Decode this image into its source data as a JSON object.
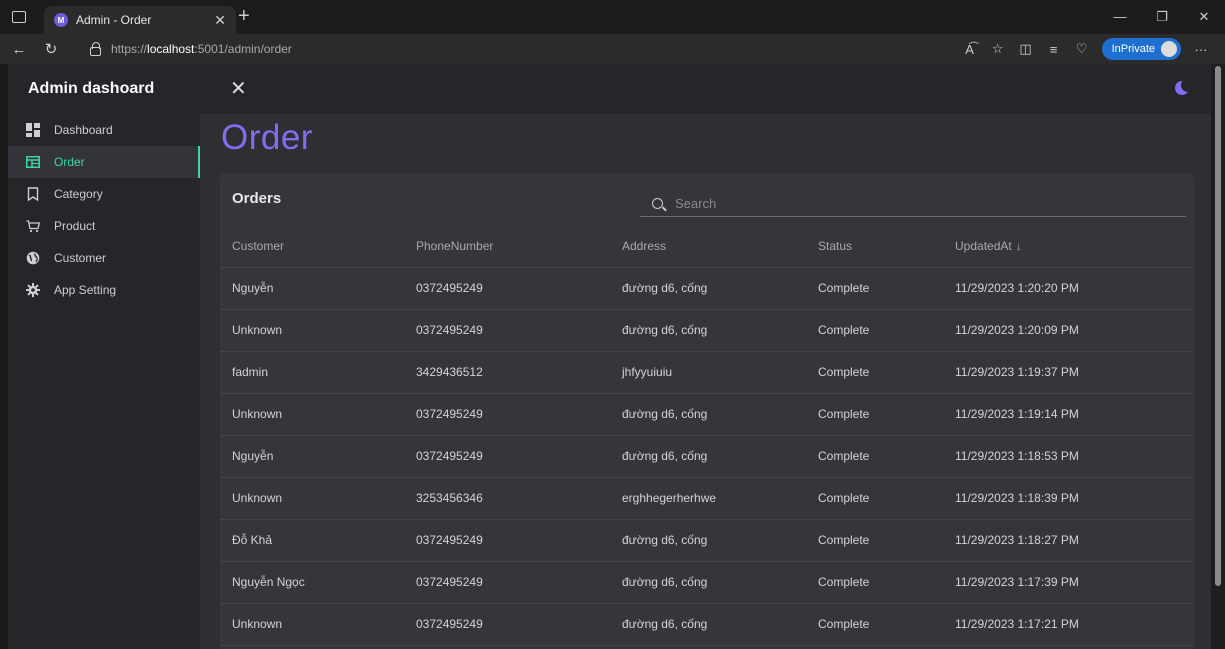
{
  "browser": {
    "tab_title": "Admin - Order",
    "new_tab": "+",
    "url_prefix": "https://",
    "url_host": "localhost",
    "url_rest": ":5001/admin/order",
    "inprivate_label": "InPrivate"
  },
  "sidebar": {
    "title": "Admin dashoard",
    "items": [
      {
        "label": "Dashboard",
        "icon": "dashboard-icon"
      },
      {
        "label": "Order",
        "icon": "order-icon",
        "active": true
      },
      {
        "label": "Category",
        "icon": "bookmark-icon"
      },
      {
        "label": "Product",
        "icon": "cart-icon"
      },
      {
        "label": "Customer",
        "icon": "globe-icon"
      },
      {
        "label": "App Setting",
        "icon": "gear-icon"
      }
    ]
  },
  "page": {
    "title": "Order"
  },
  "orders": {
    "title": "Orders",
    "search_placeholder": "Search",
    "columns": [
      "Customer",
      "PhoneNumber",
      "Address",
      "Status",
      "UpdatedAt"
    ],
    "sort_indicator": "↓",
    "rows": [
      [
        "Nguyễn",
        "0372495249",
        "đường d6, cống",
        "Complete",
        "11/29/2023 1:20:20 PM"
      ],
      [
        "Unknown",
        "0372495249",
        "đường d6, cống",
        "Complete",
        "11/29/2023 1:20:09 PM"
      ],
      [
        "fadmin",
        "3429436512",
        "jhfyyuiuiu",
        "Complete",
        "11/29/2023 1:19:37 PM"
      ],
      [
        "Unknown",
        "0372495249",
        "đường d6, cống",
        "Complete",
        "11/29/2023 1:19:14 PM"
      ],
      [
        "Nguyễn",
        "0372495249",
        "đường d6, cống",
        "Complete",
        "11/29/2023 1:18:53 PM"
      ],
      [
        "Unknown",
        "3253456346",
        "erghhegerherhwe",
        "Complete",
        "11/29/2023 1:18:39 PM"
      ],
      [
        "Đỗ Khả",
        "0372495249",
        "đường d6, cống",
        "Complete",
        "11/29/2023 1:18:27 PM"
      ],
      [
        "Nguyễn Ngọc",
        "0372495249",
        "đường d6, cống",
        "Complete",
        "11/29/2023 1:17:39 PM"
      ],
      [
        "Unknown",
        "0372495249",
        "đường d6, cống",
        "Complete",
        "11/29/2023 1:17:21 PM"
      ]
    ]
  },
  "colors": {
    "accent": "#7f6ff0",
    "active_nav": "#3ad7a6",
    "background": "#2e2e33"
  }
}
